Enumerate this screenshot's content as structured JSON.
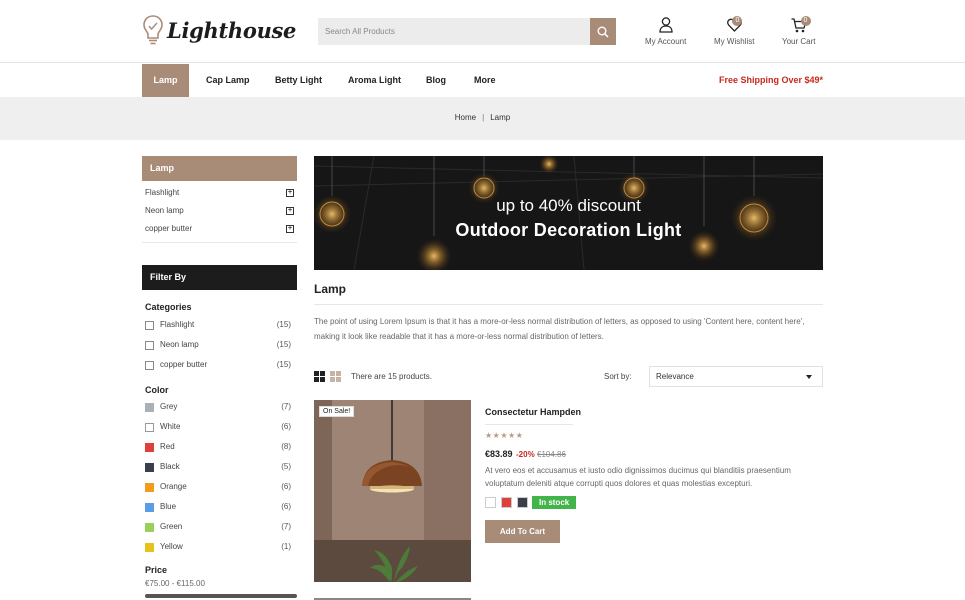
{
  "brand": {
    "name": "Lighthouse"
  },
  "search": {
    "placeholder": "Search All Products"
  },
  "header_actions": {
    "account": "My Account",
    "wishlist": "My Wishlist",
    "wishlist_count": "0",
    "cart": "Your Cart",
    "cart_count": "0"
  },
  "nav": {
    "items": [
      "Lamp",
      "Cap Lamp",
      "Betty Light",
      "Aroma Light",
      "Blog",
      "More"
    ],
    "promo": "Free Shipping Over $49*"
  },
  "breadcrumb": {
    "home": "Home",
    "separator": "|",
    "current": "Lamp"
  },
  "sidebar": {
    "category_title": "Lamp",
    "categories": [
      "Flashlight",
      "Neon lamp",
      "copper butter"
    ],
    "filter_title": "Filter By",
    "filter_categories_title": "Categories",
    "filter_categories": [
      {
        "label": "Flashlight",
        "count": "(15)"
      },
      {
        "label": "Neon lamp",
        "count": "(15)"
      },
      {
        "label": "copper butter",
        "count": "(15)"
      }
    ],
    "color_title": "Color",
    "colors": [
      {
        "label": "Grey",
        "count": "(7)",
        "hex": "#aab0b6"
      },
      {
        "label": "White",
        "count": "(6)",
        "hex": "#ffffff"
      },
      {
        "label": "Red",
        "count": "(8)",
        "hex": "#e0403a"
      },
      {
        "label": "Black",
        "count": "(5)",
        "hex": "#3a3f4a"
      },
      {
        "label": "Orange",
        "count": "(6)",
        "hex": "#f29b1d"
      },
      {
        "label": "Blue",
        "count": "(6)",
        "hex": "#5a9ce6"
      },
      {
        "label": "Green",
        "count": "(7)",
        "hex": "#98d05a"
      },
      {
        "label": "Yellow",
        "count": "(1)",
        "hex": "#e8c21c"
      }
    ],
    "price_title": "Price",
    "price_range": "€75.00 - €115.00"
  },
  "banner": {
    "subtitle": "up to 40% discount",
    "title": "Outdoor Decoration Light"
  },
  "category": {
    "title": "Lamp",
    "description": "The point of using Lorem Ipsum is that it has a more-or-less normal distribution of letters, as opposed to using 'Content here, content here', making it look like readable that it has a more-or-less normal distribution of letters."
  },
  "listing": {
    "count_text": "There are 15 products.",
    "sort_label": "Sort by:",
    "sort_value": "Relevance"
  },
  "product": {
    "sale_badge": "On Sale!",
    "name": "Consectetur Hampden",
    "stars": "★★★★★",
    "price": "€83.89",
    "discount": "-20%",
    "old_price": "€104.86",
    "description": "At vero eos et accusamus et iusto odio dignissimos ducimus qui blanditiis praesentium voluptatum deleniti atque corrupti quos dolores et quas molestias excepturi.",
    "swatches": [
      "#ffffff",
      "#e0403a",
      "#3a3f4a"
    ],
    "stock": "In stock",
    "add_to_cart": "Add To Cart"
  },
  "colors": {
    "accent": "#a98c78",
    "sale_red": "#c8281f",
    "stock_green": "#42b44a"
  }
}
